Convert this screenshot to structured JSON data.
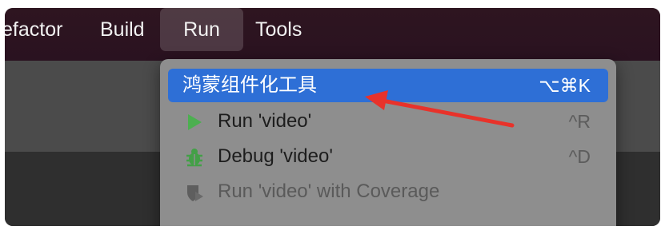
{
  "menubar": {
    "items": [
      {
        "label": "efactor"
      },
      {
        "label": "Build"
      },
      {
        "label": "Run"
      },
      {
        "label": "Tools"
      }
    ]
  },
  "run_menu": {
    "items": [
      {
        "label": "鸿蒙组件化工具",
        "shortcut": "⌥⌘K",
        "icon": "none",
        "highlighted": true
      },
      {
        "label": "Run 'video'",
        "shortcut": "^R",
        "icon": "play-icon"
      },
      {
        "label": "Debug 'video'",
        "shortcut": "^D",
        "icon": "bug-icon"
      },
      {
        "label": "Run 'video' with Coverage",
        "shortcut": "",
        "icon": "coverage-shield-icon",
        "disabled": true
      }
    ]
  },
  "colors": {
    "highlight": "#2e6fd6",
    "annotation_arrow": "#e8322a",
    "play_green": "#4caf50",
    "bug_green": "#43a047"
  }
}
